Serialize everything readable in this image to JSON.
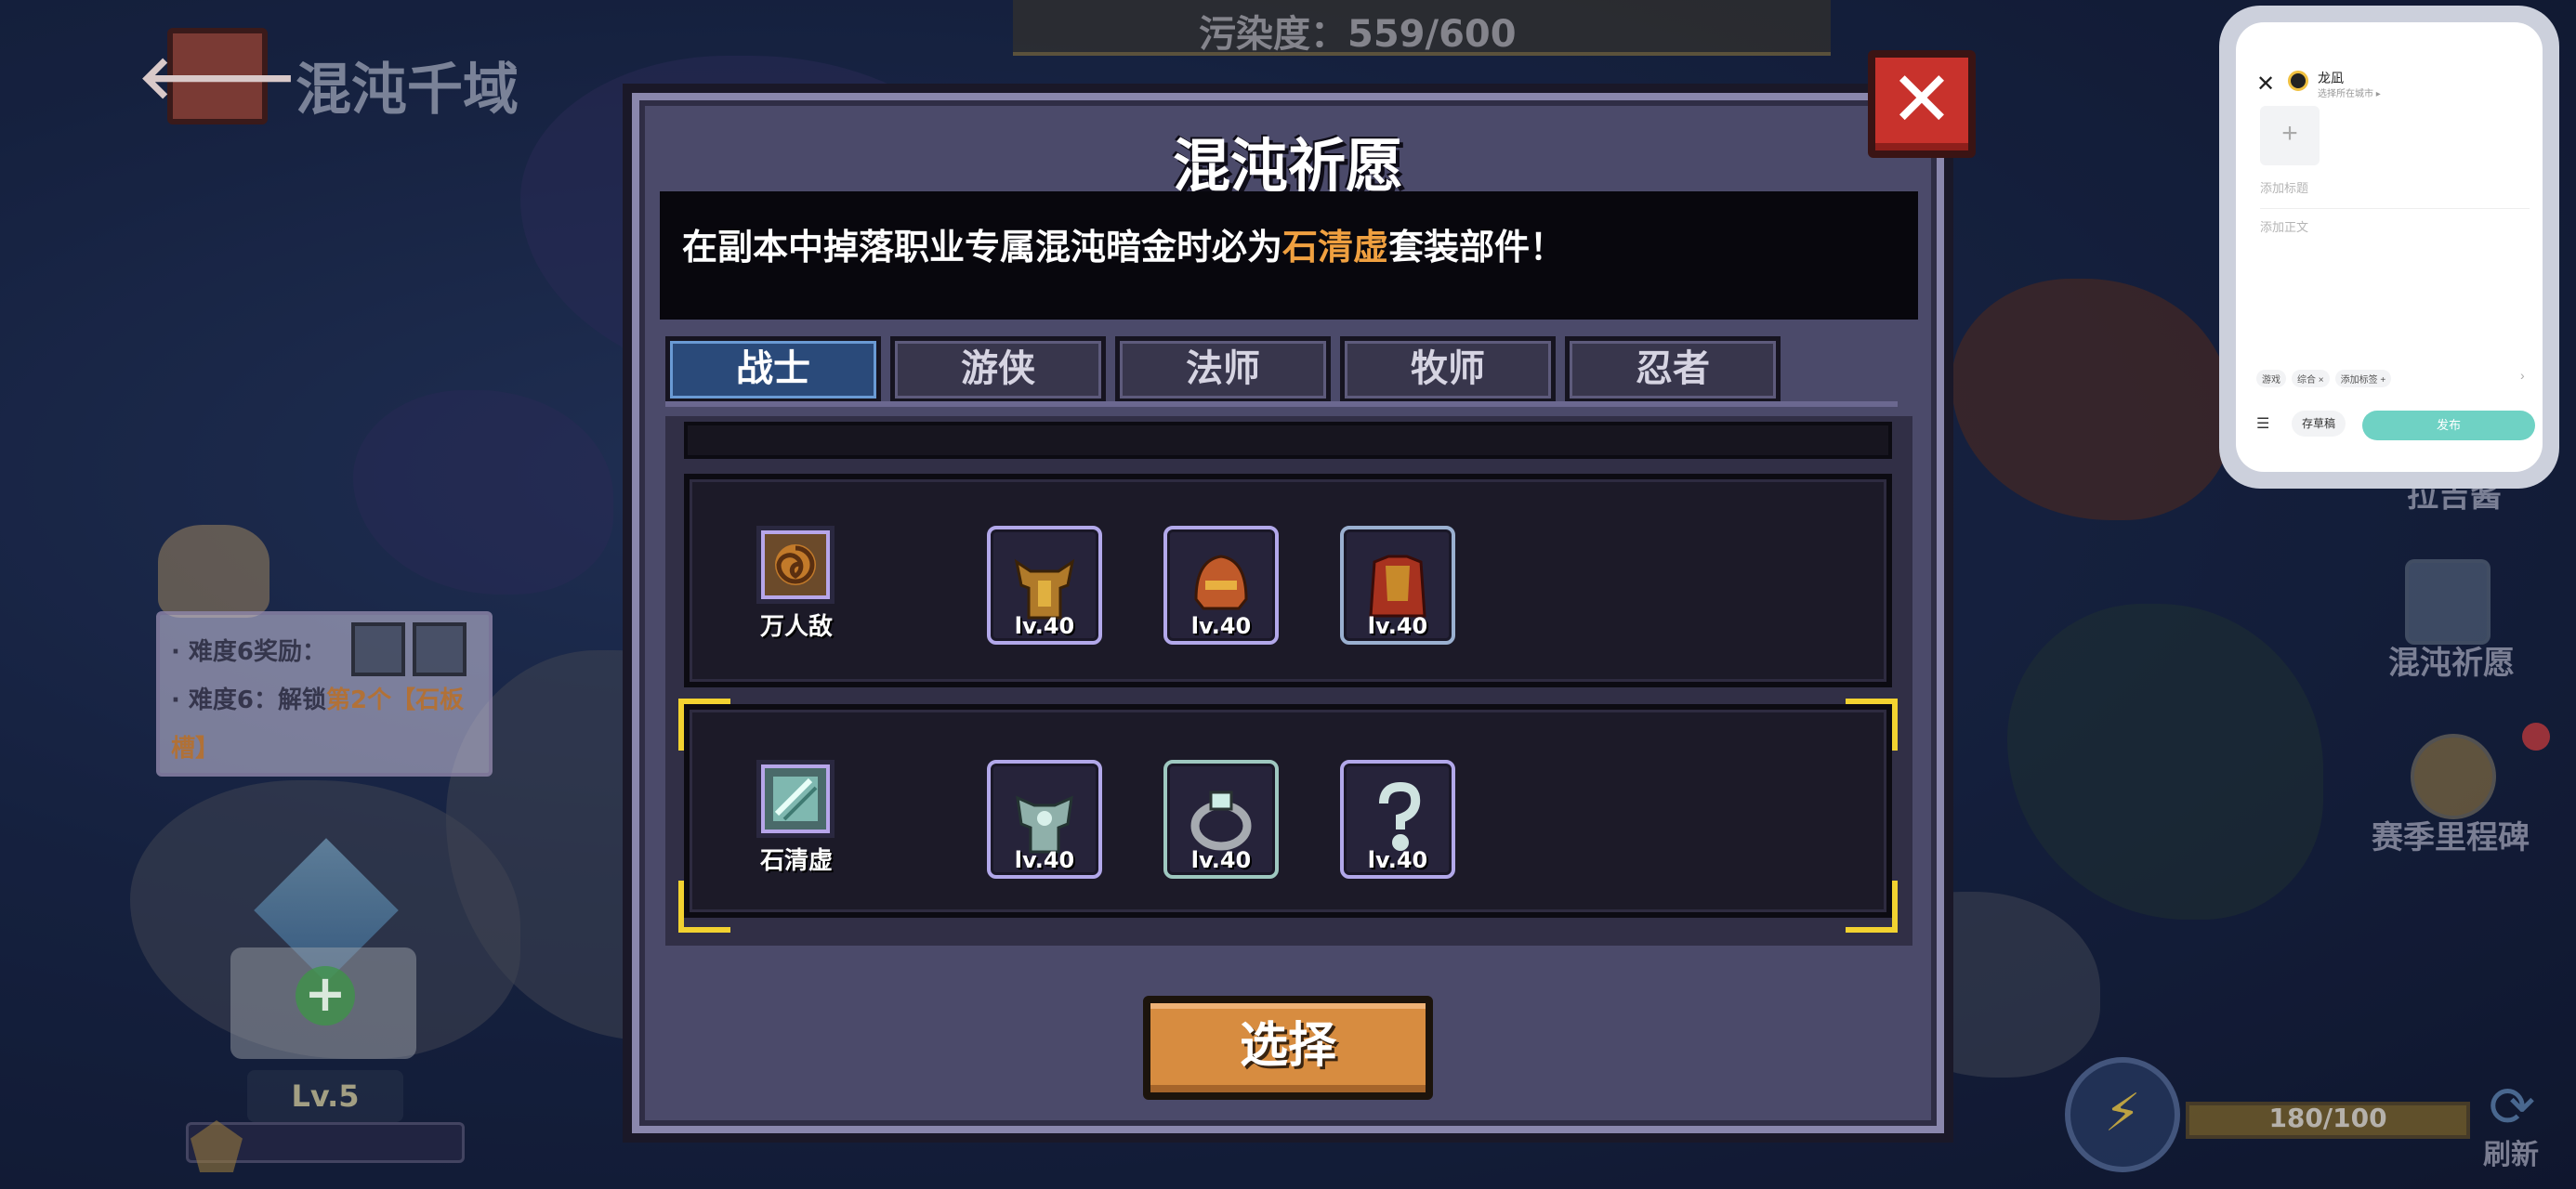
{
  "background": {
    "pollution_text": "污染度：559/600",
    "region_title": "混沌千域",
    "tip": {
      "reward_line": "· 难度6奖励：",
      "unlock_prefix": "· 难度6：解锁",
      "unlock_highlight": "第2个【石板槽】"
    },
    "base_level": "Lv.5",
    "side": {
      "top_label": "拉吉酱",
      "wish_label": "混沌祈愿",
      "milestone_label": "赛季里程碑"
    },
    "energy_text": "180/100",
    "refresh_label": "刷新"
  },
  "dialog": {
    "title": "混沌祈愿",
    "description": {
      "prefix": "在副本中掉落职业专属混沌暗金时必为",
      "highlight": "石清虚",
      "suffix": "套装部件！"
    },
    "tabs": [
      "战士",
      "游侠",
      "法师",
      "牧师",
      "忍者"
    ],
    "active_tab": 0,
    "sets": [
      {
        "name": "万人敌",
        "icon": "swirl-set-icon",
        "items": [
          {
            "icon": "horned-armor-icon",
            "level": "lv.40"
          },
          {
            "icon": "helmet-icon",
            "level": "lv.40"
          },
          {
            "icon": "caped-armor-icon",
            "level": "lv.40"
          }
        ],
        "selected": false
      },
      {
        "name": "石清虚",
        "icon": "jade-slab-icon",
        "items": [
          {
            "icon": "jade-armor-icon",
            "level": "lv.40"
          },
          {
            "icon": "jade-ring-icon",
            "level": "lv.40"
          },
          {
            "icon": "jade-amulet-icon",
            "level": "lv.40"
          }
        ],
        "selected": true
      }
    ],
    "select_button": "选择"
  },
  "phone": {
    "user_name": "龙凪",
    "user_sub": "选择所在城市 ▸",
    "title_placeholder": "添加标题",
    "body_placeholder": "添加正文",
    "tags": [
      "游戏",
      "综合 ×",
      "添加标签 +"
    ],
    "draft_button": "存草稿",
    "publish_button": "发布"
  },
  "colors": {
    "highlight": "#f0a040",
    "close_button": "#c8322c",
    "select_button": "#d78c40",
    "active_tab": "#2a4a7a",
    "selection_corner": "#f2d230",
    "publish": "#6fd2c4"
  }
}
